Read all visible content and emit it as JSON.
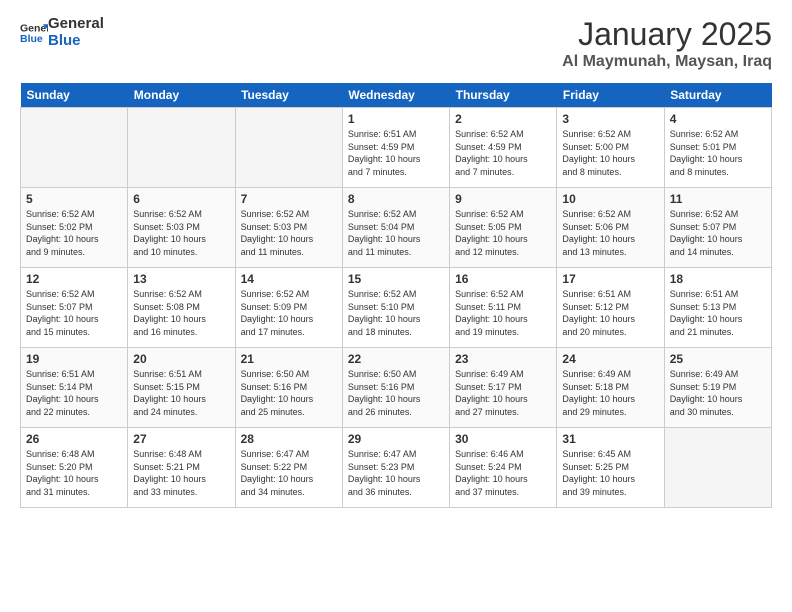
{
  "logo": {
    "line1": "General",
    "line2": "Blue"
  },
  "title": "January 2025",
  "location": "Al Maymunah, Maysan, Iraq",
  "days_of_week": [
    "Sunday",
    "Monday",
    "Tuesday",
    "Wednesday",
    "Thursday",
    "Friday",
    "Saturday"
  ],
  "weeks": [
    [
      {
        "day": "",
        "info": ""
      },
      {
        "day": "",
        "info": ""
      },
      {
        "day": "",
        "info": ""
      },
      {
        "day": "1",
        "info": "Sunrise: 6:51 AM\nSunset: 4:59 PM\nDaylight: 10 hours\nand 7 minutes."
      },
      {
        "day": "2",
        "info": "Sunrise: 6:52 AM\nSunset: 4:59 PM\nDaylight: 10 hours\nand 7 minutes."
      },
      {
        "day": "3",
        "info": "Sunrise: 6:52 AM\nSunset: 5:00 PM\nDaylight: 10 hours\nand 8 minutes."
      },
      {
        "day": "4",
        "info": "Sunrise: 6:52 AM\nSunset: 5:01 PM\nDaylight: 10 hours\nand 8 minutes."
      }
    ],
    [
      {
        "day": "5",
        "info": "Sunrise: 6:52 AM\nSunset: 5:02 PM\nDaylight: 10 hours\nand 9 minutes."
      },
      {
        "day": "6",
        "info": "Sunrise: 6:52 AM\nSunset: 5:03 PM\nDaylight: 10 hours\nand 10 minutes."
      },
      {
        "day": "7",
        "info": "Sunrise: 6:52 AM\nSunset: 5:03 PM\nDaylight: 10 hours\nand 11 minutes."
      },
      {
        "day": "8",
        "info": "Sunrise: 6:52 AM\nSunset: 5:04 PM\nDaylight: 10 hours\nand 11 minutes."
      },
      {
        "day": "9",
        "info": "Sunrise: 6:52 AM\nSunset: 5:05 PM\nDaylight: 10 hours\nand 12 minutes."
      },
      {
        "day": "10",
        "info": "Sunrise: 6:52 AM\nSunset: 5:06 PM\nDaylight: 10 hours\nand 13 minutes."
      },
      {
        "day": "11",
        "info": "Sunrise: 6:52 AM\nSunset: 5:07 PM\nDaylight: 10 hours\nand 14 minutes."
      }
    ],
    [
      {
        "day": "12",
        "info": "Sunrise: 6:52 AM\nSunset: 5:07 PM\nDaylight: 10 hours\nand 15 minutes."
      },
      {
        "day": "13",
        "info": "Sunrise: 6:52 AM\nSunset: 5:08 PM\nDaylight: 10 hours\nand 16 minutes."
      },
      {
        "day": "14",
        "info": "Sunrise: 6:52 AM\nSunset: 5:09 PM\nDaylight: 10 hours\nand 17 minutes."
      },
      {
        "day": "15",
        "info": "Sunrise: 6:52 AM\nSunset: 5:10 PM\nDaylight: 10 hours\nand 18 minutes."
      },
      {
        "day": "16",
        "info": "Sunrise: 6:52 AM\nSunset: 5:11 PM\nDaylight: 10 hours\nand 19 minutes."
      },
      {
        "day": "17",
        "info": "Sunrise: 6:51 AM\nSunset: 5:12 PM\nDaylight: 10 hours\nand 20 minutes."
      },
      {
        "day": "18",
        "info": "Sunrise: 6:51 AM\nSunset: 5:13 PM\nDaylight: 10 hours\nand 21 minutes."
      }
    ],
    [
      {
        "day": "19",
        "info": "Sunrise: 6:51 AM\nSunset: 5:14 PM\nDaylight: 10 hours\nand 22 minutes."
      },
      {
        "day": "20",
        "info": "Sunrise: 6:51 AM\nSunset: 5:15 PM\nDaylight: 10 hours\nand 24 minutes."
      },
      {
        "day": "21",
        "info": "Sunrise: 6:50 AM\nSunset: 5:16 PM\nDaylight: 10 hours\nand 25 minutes."
      },
      {
        "day": "22",
        "info": "Sunrise: 6:50 AM\nSunset: 5:16 PM\nDaylight: 10 hours\nand 26 minutes."
      },
      {
        "day": "23",
        "info": "Sunrise: 6:49 AM\nSunset: 5:17 PM\nDaylight: 10 hours\nand 27 minutes."
      },
      {
        "day": "24",
        "info": "Sunrise: 6:49 AM\nSunset: 5:18 PM\nDaylight: 10 hours\nand 29 minutes."
      },
      {
        "day": "25",
        "info": "Sunrise: 6:49 AM\nSunset: 5:19 PM\nDaylight: 10 hours\nand 30 minutes."
      }
    ],
    [
      {
        "day": "26",
        "info": "Sunrise: 6:48 AM\nSunset: 5:20 PM\nDaylight: 10 hours\nand 31 minutes."
      },
      {
        "day": "27",
        "info": "Sunrise: 6:48 AM\nSunset: 5:21 PM\nDaylight: 10 hours\nand 33 minutes."
      },
      {
        "day": "28",
        "info": "Sunrise: 6:47 AM\nSunset: 5:22 PM\nDaylight: 10 hours\nand 34 minutes."
      },
      {
        "day": "29",
        "info": "Sunrise: 6:47 AM\nSunset: 5:23 PM\nDaylight: 10 hours\nand 36 minutes."
      },
      {
        "day": "30",
        "info": "Sunrise: 6:46 AM\nSunset: 5:24 PM\nDaylight: 10 hours\nand 37 minutes."
      },
      {
        "day": "31",
        "info": "Sunrise: 6:45 AM\nSunset: 5:25 PM\nDaylight: 10 hours\nand 39 minutes."
      },
      {
        "day": "",
        "info": ""
      }
    ]
  ]
}
